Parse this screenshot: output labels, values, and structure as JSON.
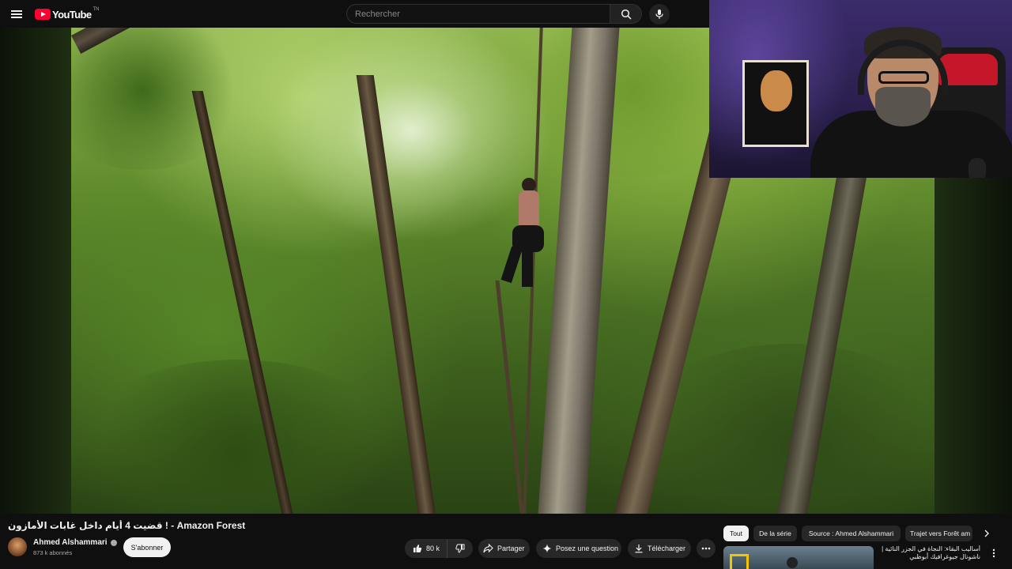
{
  "header": {
    "logo_text": "YouTube",
    "logo_sup": "TN",
    "search_placeholder": "Rechercher"
  },
  "video": {
    "title": "قضيت 4 أيام داخل غابات الأمازون ! - Amazon Forest"
  },
  "channel": {
    "name": "Ahmed Alshammari",
    "subscribers": "873 k abonnés",
    "subscribe_label": "S'abonner"
  },
  "actions": {
    "likes": "80 k",
    "share_label": "Partager",
    "ask_label": "Posez une question",
    "download_label": "Télécharger"
  },
  "chips": [
    {
      "label": "Tout",
      "active": true
    },
    {
      "label": "De la série",
      "active": false
    },
    {
      "label": "Source : Ahmed Alshammari",
      "active": false
    },
    {
      "label": "Trajet vers Forêt am",
      "active": false
    }
  ],
  "recommendation": {
    "title": "أساليب البقاء: النجاة في الجزر النائية | ناشونال جيوغرافيك أبوظبي"
  },
  "colors": {
    "background": "#0f0f0f",
    "brand_red": "#ff0033",
    "chip_bg": "#272727",
    "text_primary": "#f1f1f1",
    "text_secondary": "#aaaaaa"
  },
  "icons": {
    "menu": "menu-icon",
    "search": "search-icon",
    "mic": "mic-icon",
    "like": "thumbs-up-icon",
    "dislike": "thumbs-down-icon",
    "share": "share-icon",
    "ask": "sparkle-icon",
    "download": "download-icon",
    "more": "more-horizontal-icon",
    "chevron": "chevron-right-icon"
  }
}
